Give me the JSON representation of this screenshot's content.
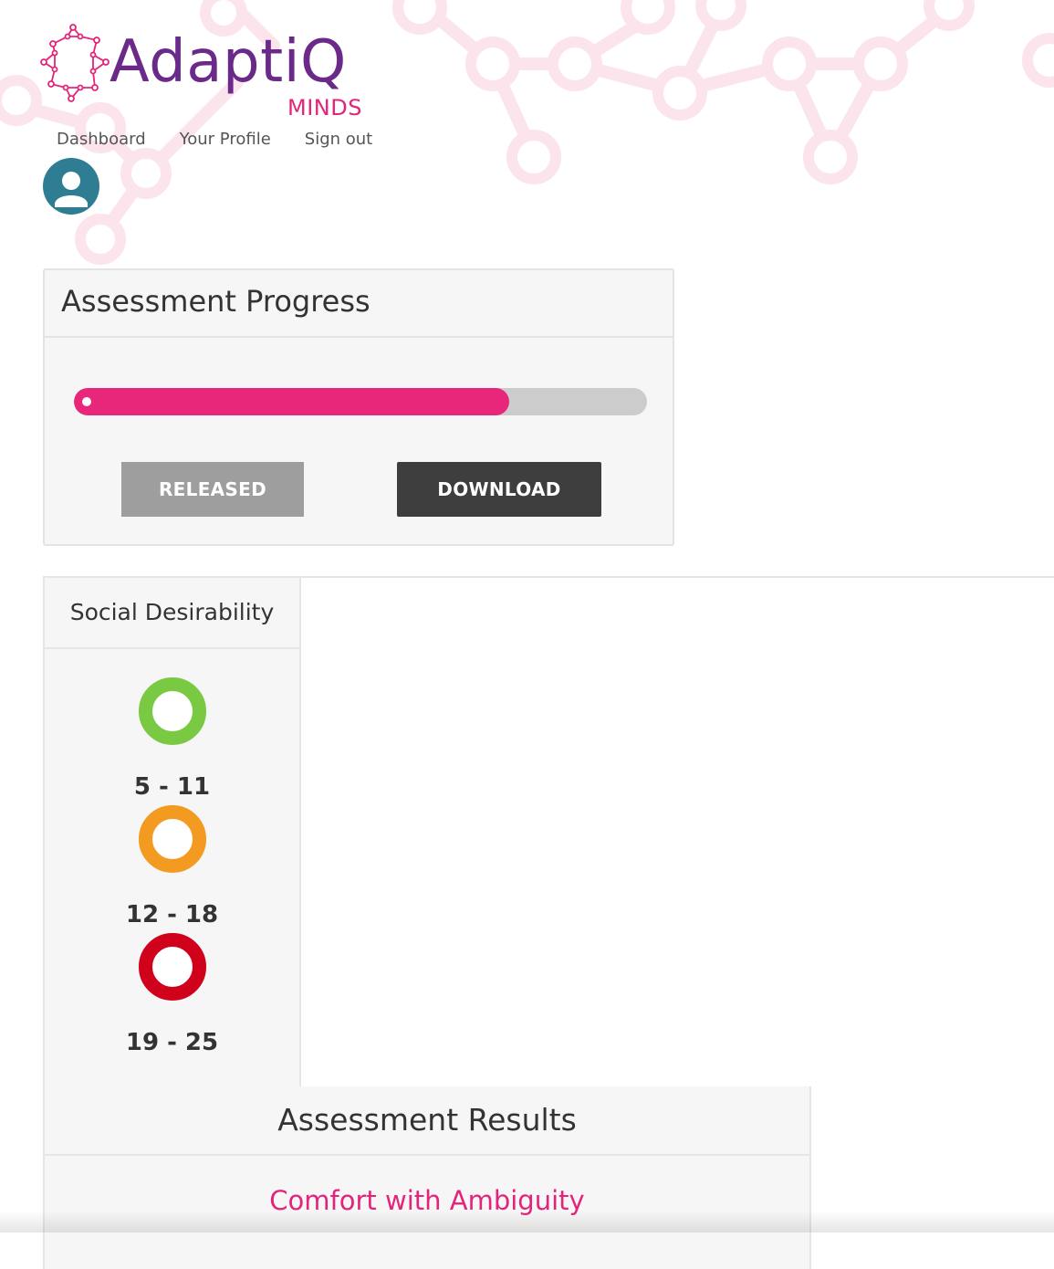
{
  "brand": {
    "name": "AdaptiQ",
    "sub": "MINDS",
    "primary_color": "#6b2a8a",
    "accent_color": "#e4247a",
    "logo_icon": "molecule-icon"
  },
  "nav": {
    "items": [
      {
        "label": "Dashboard"
      },
      {
        "label": "Your Profile"
      },
      {
        "label": "Sign out"
      }
    ]
  },
  "user": {
    "avatar_icon": "user-avatar-icon"
  },
  "progress": {
    "title": "Assessment Progress",
    "value_percent": 76,
    "bar_color": "#e8267a",
    "buttons": {
      "released": "RELEASED",
      "download": "DOWNLOAD"
    }
  },
  "social_desirability": {
    "title": "Social Desirability",
    "levels": [
      {
        "range": "5 - 11",
        "color": "#7ac943"
      },
      {
        "range": "12 - 18",
        "color": "#f29b20"
      },
      {
        "range": "19 - 25",
        "color": "#d0021b"
      }
    ]
  },
  "results": {
    "title": "Assessment Results",
    "first_item": "Comfort with Ambiguity"
  }
}
